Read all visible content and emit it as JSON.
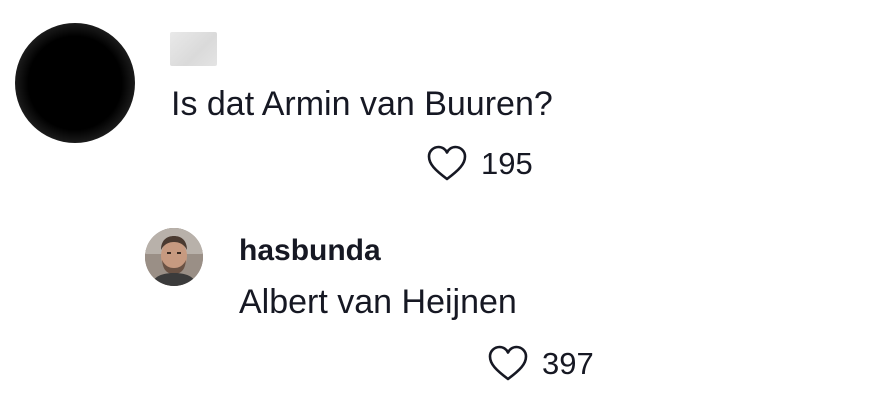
{
  "comments": [
    {
      "username": "",
      "avatar": "blurred-avatar",
      "text": "Is dat Armin van Buuren?",
      "likes": "195",
      "like_icon": "heart-outline-icon"
    }
  ],
  "reply": {
    "username": "hasbunda",
    "avatar": "profile-photo",
    "text": "Albert van Heijnen",
    "likes": "397",
    "like_icon": "heart-outline-icon"
  },
  "colors": {
    "text": "#161823",
    "icon": "#161823",
    "background": "#ffffff"
  }
}
